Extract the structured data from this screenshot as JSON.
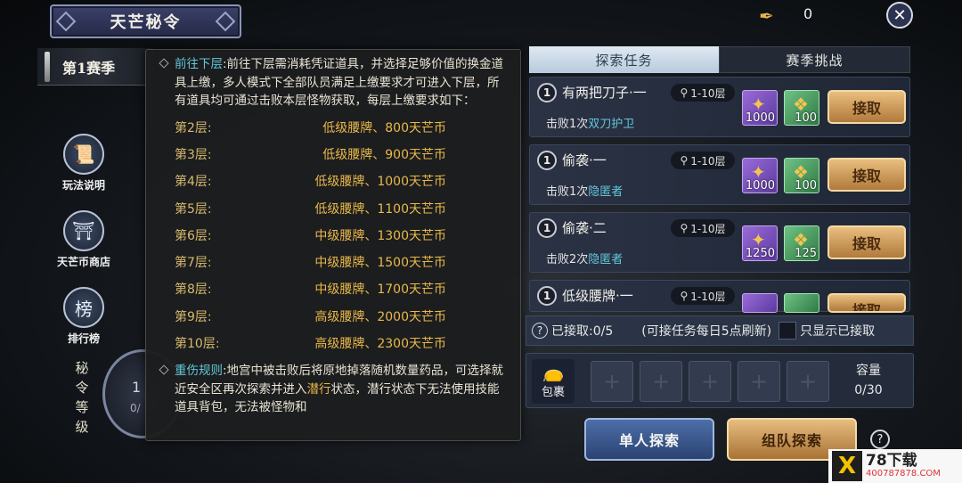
{
  "header": {
    "title": "天芒秘令",
    "season": "第1赛季",
    "currency_value": "0",
    "currency_icon": "quill-coin-icon",
    "close_icon": "close-icon"
  },
  "side_menu": [
    {
      "label": "玩法说明",
      "icon": "scroll-icon"
    },
    {
      "label": "天芒币商店",
      "icon": "shop-icon"
    },
    {
      "label": "排行榜",
      "icon": "rank-badge-icon"
    }
  ],
  "rank": {
    "vertical_label": "秘令等级",
    "level_partial": "1",
    "progress_partial": "0/"
  },
  "tooltip": {
    "p1_key": "前往下层",
    "p1_text": ":前往下层需消耗凭证道具，并选择足够价值的换金道具上缴，多人模式下全部队员满足上缴要求才可进入下层，所有道具均可通过击败本层怪物获取，每层上缴要求如下：",
    "floors": [
      {
        "floor": "第2层:",
        "req": "低级腰牌、800天芒币"
      },
      {
        "floor": "第3层:",
        "req": "低级腰牌、900天芒币"
      },
      {
        "floor": "第4层:",
        "req": "低级腰牌、1000天芒币"
      },
      {
        "floor": "第5层:",
        "req": "低级腰牌、1100天芒币"
      },
      {
        "floor": "第6层:",
        "req": "中级腰牌、1300天芒币"
      },
      {
        "floor": "第7层:",
        "req": "中级腰牌、1500天芒币"
      },
      {
        "floor": "第8层:",
        "req": "中级腰牌、1700天芒币"
      },
      {
        "floor": "第9层:",
        "req": "高级腰牌、2000天芒币"
      },
      {
        "floor": "第10层:",
        "req": "高级腰牌、2300天芒币"
      }
    ],
    "p2_key": "重伤规则",
    "p2_text_a": ":地宫中被击败后将原地掉落随机数量药品，可选择就近安全区再次探索并进入",
    "p2_hl": "潜行",
    "p2_text_b": "状态，潜行状态下无法使用技能道具背包，无法被怪物和"
  },
  "tabs": {
    "explore": "探索任务",
    "season": "赛季挑战"
  },
  "tasks": [
    {
      "num": "1",
      "name": "有两把刀子·一",
      "level": "1-10层",
      "desc_prefix": "击败1次",
      "target": "双刀护卫",
      "reward1": "1000",
      "reward2": "100",
      "accept": "接取"
    },
    {
      "num": "1",
      "name": "偷袭·一",
      "level": "1-10层",
      "desc_prefix": "击败1次",
      "target": "隐匿者",
      "reward1": "1000",
      "reward2": "100",
      "accept": "接取"
    },
    {
      "num": "1",
      "name": "偷袭·二",
      "level": "1-10层",
      "desc_prefix": "击败2次",
      "target": "隐匿者",
      "reward1": "1250",
      "reward2": "125",
      "accept": "接取"
    },
    {
      "num": "1",
      "name": "低级腰牌·一",
      "level": "1-10层",
      "desc_prefix": "",
      "target": "",
      "reward1": "",
      "reward2": "",
      "accept": "接取"
    }
  ],
  "status": {
    "accepted": "已接取:0/5",
    "note": "(可接任务每日5点刷新)",
    "filter": "只显示已接取"
  },
  "bag": {
    "label": "包裹",
    "capacity_label": "容量",
    "capacity": "0/30"
  },
  "buttons": {
    "solo": "单人探索",
    "team": "组队探索"
  },
  "watermark": {
    "brand": "78下载",
    "url": "400787878.COM"
  }
}
